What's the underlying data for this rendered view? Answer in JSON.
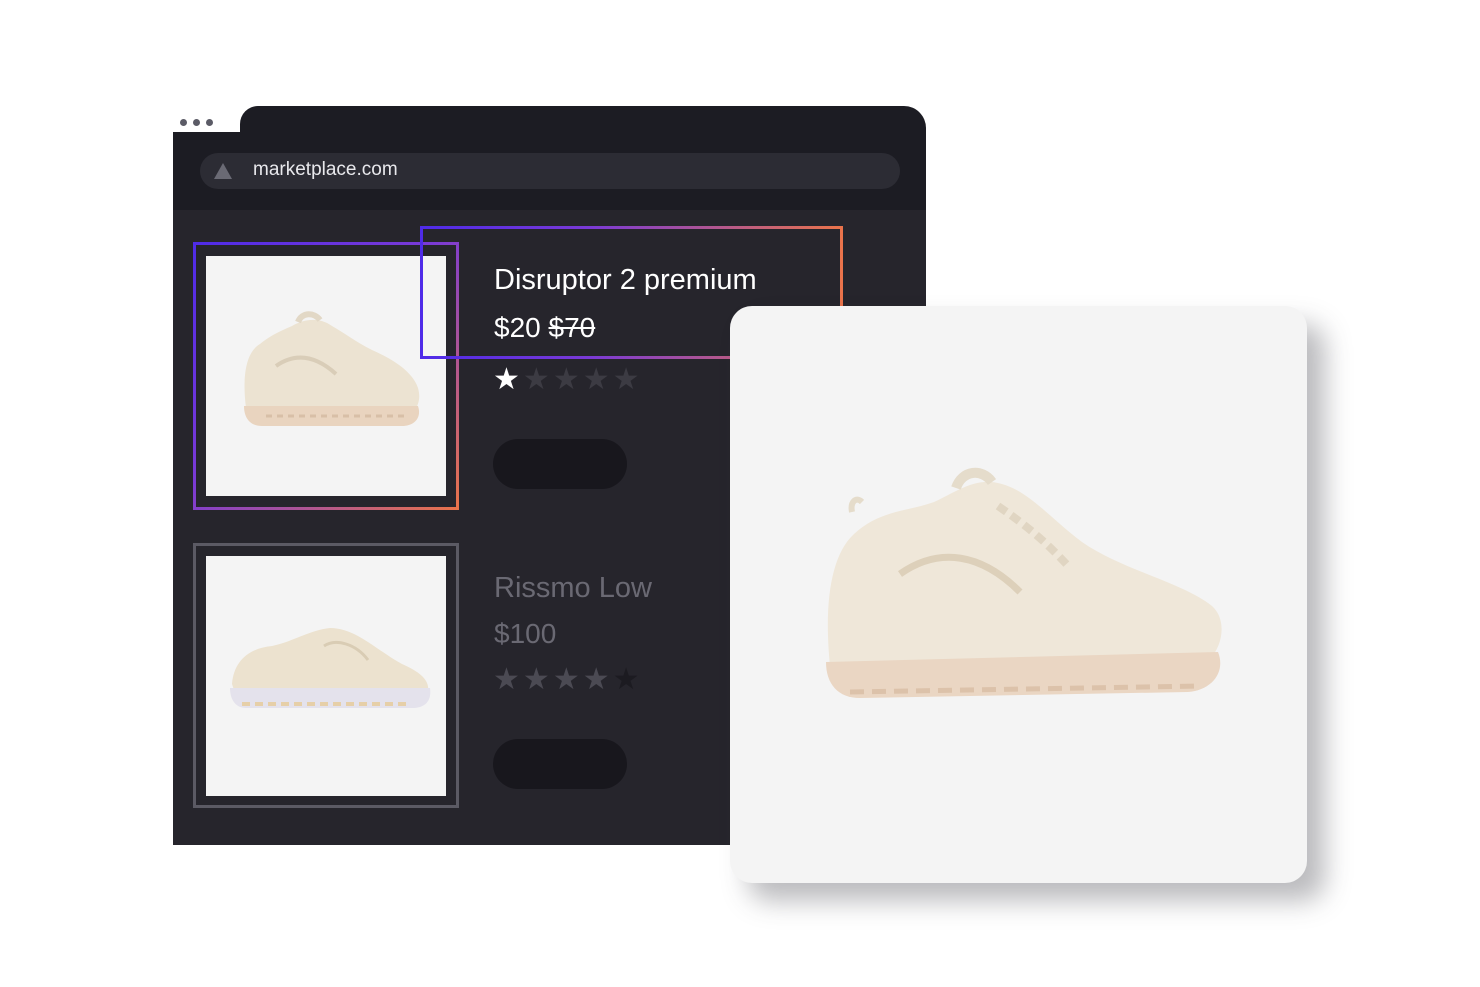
{
  "browser": {
    "url": "marketplace.com",
    "url_icon": "triangle-icon"
  },
  "products": [
    {
      "title": "Disruptor 2 premium",
      "price": "$20",
      "old_price": "$70",
      "rating": 1,
      "rating_max": 5,
      "image": "chunky-cream-sneaker"
    },
    {
      "title": "Rissmo Low",
      "price": "$100",
      "rating": 4,
      "rating_max": 5,
      "image": "low-cream-sneaker"
    }
  ],
  "preview_card": {
    "image": "chunky-cream-sneaker-large"
  },
  "colors": {
    "accent_start": "#4f2be8",
    "accent_end": "#e9734b",
    "window_bg": "#26252c"
  }
}
